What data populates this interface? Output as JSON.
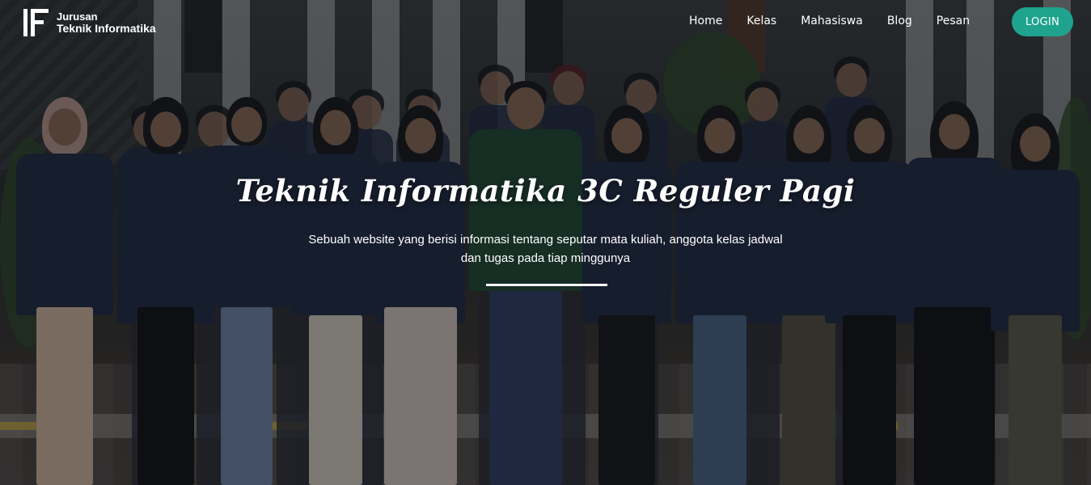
{
  "brand": {
    "logo_letters": "IF",
    "line1": "Jurusan",
    "line2": "Teknik Informatika"
  },
  "nav": {
    "items": [
      "Home",
      "Kelas",
      "Mahasiswa",
      "Blog",
      "Pesan"
    ],
    "login_label": "LOGIN"
  },
  "hero": {
    "title": "Teknik Informatika 3C Reguler Pagi",
    "subtitle": "Sebuah website yang berisi informasi tentang seputar mata kuliah, anggota kelas jadwal dan tugas pada tiap minggunya"
  },
  "colors": {
    "accent": "#1fa38f",
    "text": "#ffffff",
    "overlay": "rgba(12,14,18,0.45)"
  }
}
